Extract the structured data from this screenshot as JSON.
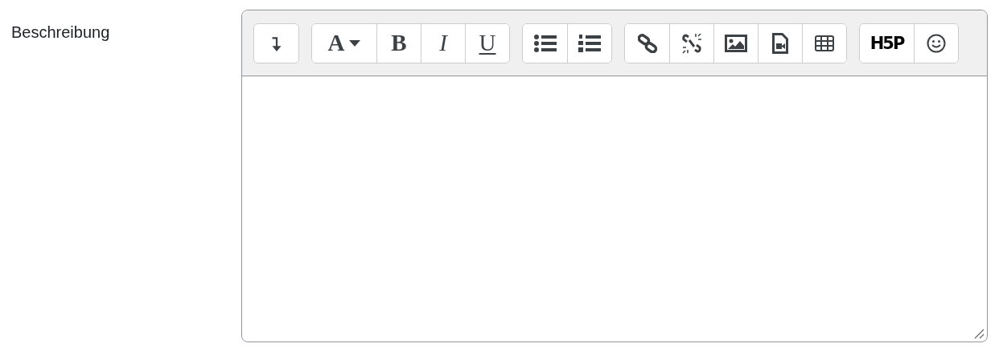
{
  "field": {
    "label": "Beschreibung"
  },
  "toolbar": [
    {
      "buttons": [
        {
          "kind": "toggle"
        }
      ]
    },
    {
      "buttons": [
        {
          "kind": "dropdown",
          "label": "A"
        },
        {
          "kind": "bold",
          "label": "B"
        },
        {
          "kind": "italic",
          "label": "I"
        },
        {
          "kind": "underline",
          "label": "U"
        }
      ]
    },
    {
      "buttons": [
        {
          "kind": "bullet-list"
        },
        {
          "kind": "numbered-list"
        }
      ]
    },
    {
      "buttons": [
        {
          "kind": "link"
        },
        {
          "kind": "unlink"
        },
        {
          "kind": "image"
        },
        {
          "kind": "media"
        },
        {
          "kind": "table"
        }
      ]
    },
    {
      "buttons": [
        {
          "kind": "logo",
          "label": "H5P"
        },
        {
          "kind": "emoji"
        }
      ]
    }
  ]
}
